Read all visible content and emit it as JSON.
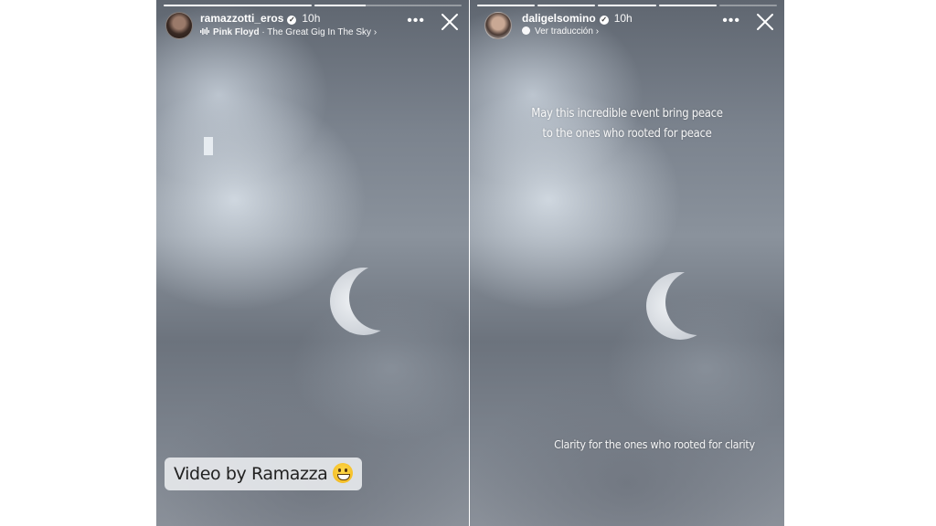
{
  "stories": [
    {
      "username": "ramazzotti_eros",
      "time": "10h",
      "music_artist": "Pink Floyd",
      "music_separator": "·",
      "music_track": "The Great Gig In The Sky",
      "caption": "Video by Ramazza",
      "caption_emoji": "grinning-face-emoji",
      "progress": [
        1,
        0.35
      ]
    },
    {
      "username": "daligelsomino",
      "time": "10h",
      "sub_text": "Ver traducción",
      "text_top_line1": "May this incredible event bring peace",
      "text_top_line2": "to the ones who rooted for peace",
      "text_bottom": "Clarity for the ones who rooted for clarity",
      "progress": [
        1,
        1,
        1,
        1,
        0
      ]
    }
  ],
  "icons": {
    "more": "more-options-icon",
    "close": "close-icon",
    "verified": "verified-badge-icon",
    "music": "music-icon",
    "translate": "translate-icon",
    "chevron": "chevron-right-icon"
  },
  "colors": {
    "page_background": "#ffffff",
    "overlay_text": "#ffffff",
    "caption_pill": "#e6e8ec"
  }
}
